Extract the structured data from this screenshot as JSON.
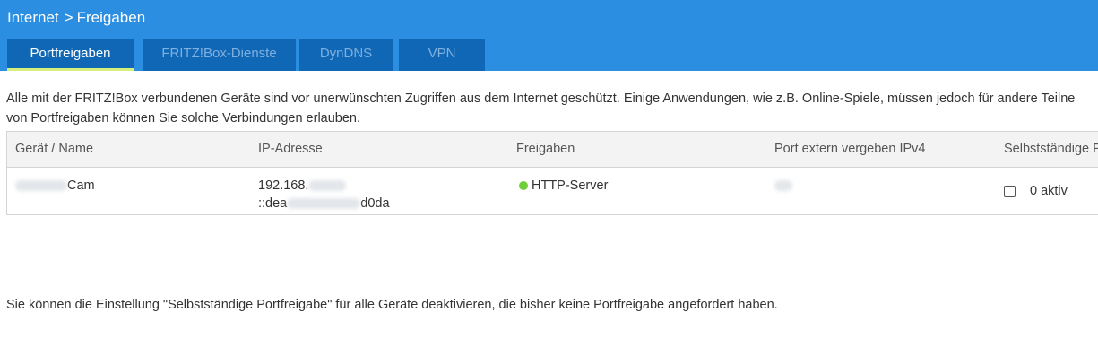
{
  "header": {
    "breadcrumb": {
      "section": "Internet",
      "separator": ">",
      "page": "Freigaben"
    },
    "tabs": [
      {
        "label": "Portfreigaben",
        "active": true
      },
      {
        "label": "FRITZ!Box-Dienste",
        "active": false
      },
      {
        "label": "DynDNS",
        "active": false
      },
      {
        "label": "VPN",
        "active": false
      }
    ]
  },
  "intro": {
    "line1": "Alle mit der FRITZ!Box verbundenen Geräte sind vor unerwünschten Zugriffen aus dem Internet geschützt. Einige Anwendungen, wie z.B. Online-Spiele, müssen jedoch für andere Teilne",
    "line2": "von Portfreigaben können Sie solche Verbindungen erlauben."
  },
  "table": {
    "columns": [
      "Gerät / Name",
      "IP-Adresse",
      "Freigaben",
      "Port extern vergeben IPv4",
      "Selbstständige Po"
    ],
    "rows": [
      {
        "name_suffix": "Cam",
        "ipv4_prefix": "192.168.",
        "ipv6_prefix": "::dea",
        "ipv6_suffix": "d0da",
        "freigabe": "HTTP-Server",
        "freigabe_status": "active",
        "selbststaendig_checked": false,
        "selbststaendig_label": "0 aktiv"
      }
    ]
  },
  "footer": {
    "text": "Sie können die Einstellung \"Selbstständige Portfreigabe\" für alle Geräte deaktivieren, die bisher keine Portfreigabe angefordert haben."
  },
  "colors": {
    "header_bg": "#2b8ee0",
    "tab_bg": "#0f67b6",
    "tab_active_underline": "#d6f07d",
    "status_green": "#6fcf3a"
  },
  "icons": {
    "status": "status-dot-icon",
    "breadcrumb_separator": "chevron-right-icon"
  }
}
